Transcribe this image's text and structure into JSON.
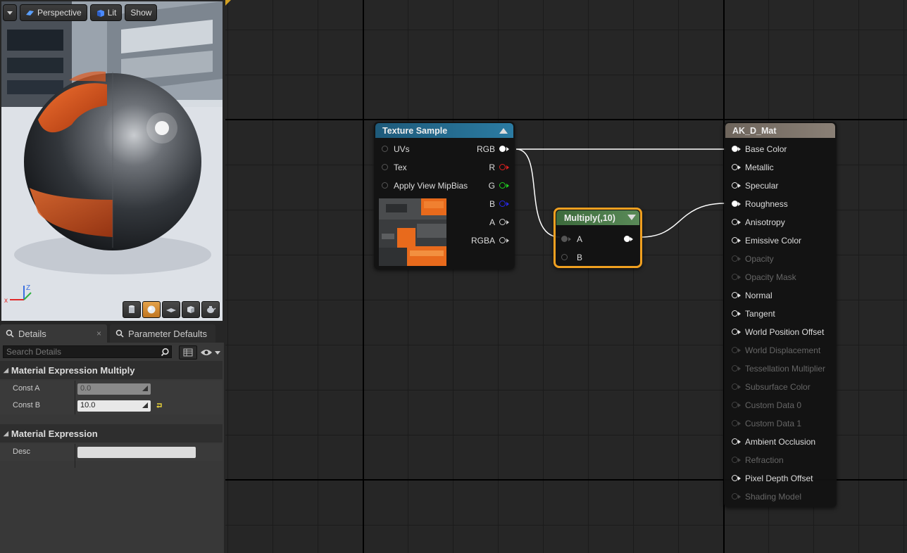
{
  "viewport": {
    "menu_icon": "chevron-down-icon",
    "perspective_label": "Perspective",
    "lit_label": "Lit",
    "show_label": "Show",
    "axis_z": "Z",
    "view_mode_icons": [
      "cylinder-icon",
      "sphere-icon",
      "plane-icon",
      "cube-icon",
      "teapot-icon"
    ]
  },
  "tabs": [
    {
      "label": "Details",
      "icon": "magnifier-icon",
      "close": "×"
    },
    {
      "label": "Parameter Defaults",
      "icon": "magnifier-icon"
    }
  ],
  "details": {
    "search_placeholder": "Search Details",
    "categories": [
      {
        "title": "Material Expression Multiply",
        "properties": [
          {
            "label": "Const A",
            "value": "0.0"
          },
          {
            "label": "Const B",
            "value": "10.0"
          }
        ]
      },
      {
        "title": "Material Expression",
        "properties": [
          {
            "label": "Desc",
            "value": ""
          }
        ]
      }
    ]
  },
  "graph": {
    "texture_sample": {
      "title": "Texture Sample",
      "inputs": [
        "UVs",
        "Tex",
        "Apply View MipBias"
      ],
      "outputs": [
        {
          "label": "RGB",
          "color": "#ffffff"
        },
        {
          "label": "R",
          "color": "#e02020"
        },
        {
          "label": "G",
          "color": "#20d020"
        },
        {
          "label": "B",
          "color": "#2828e8"
        },
        {
          "label": "A",
          "color": "#cccccc"
        },
        {
          "label": "RGBA",
          "color": "#cccccc"
        }
      ]
    },
    "multiply": {
      "title": "Multiply(,10)",
      "inputs": [
        "A",
        "B"
      ],
      "selected_color": "#f0a020"
    },
    "material": {
      "title": "AK_D_Mat",
      "inputs": [
        {
          "label": "Base Color",
          "enabled": true,
          "connected": true
        },
        {
          "label": "Metallic",
          "enabled": true,
          "connected": false
        },
        {
          "label": "Specular",
          "enabled": true,
          "connected": false
        },
        {
          "label": "Roughness",
          "enabled": true,
          "connected": true
        },
        {
          "label": "Anisotropy",
          "enabled": true,
          "connected": false
        },
        {
          "label": "Emissive Color",
          "enabled": true,
          "connected": false
        },
        {
          "label": "Opacity",
          "enabled": false,
          "connected": false
        },
        {
          "label": "Opacity Mask",
          "enabled": false,
          "connected": false
        },
        {
          "label": "Normal",
          "enabled": true,
          "connected": false
        },
        {
          "label": "Tangent",
          "enabled": true,
          "connected": false
        },
        {
          "label": "World Position Offset",
          "enabled": true,
          "connected": false
        },
        {
          "label": "World Displacement",
          "enabled": false,
          "connected": false
        },
        {
          "label": "Tessellation Multiplier",
          "enabled": false,
          "connected": false
        },
        {
          "label": "Subsurface Color",
          "enabled": false,
          "connected": false
        },
        {
          "label": "Custom Data 0",
          "enabled": false,
          "connected": false
        },
        {
          "label": "Custom Data 1",
          "enabled": false,
          "connected": false
        },
        {
          "label": "Ambient Occlusion",
          "enabled": true,
          "connected": false
        },
        {
          "label": "Refraction",
          "enabled": false,
          "connected": false
        },
        {
          "label": "Pixel Depth Offset",
          "enabled": true,
          "connected": false
        },
        {
          "label": "Shading Model",
          "enabled": false,
          "connected": false
        }
      ]
    }
  }
}
